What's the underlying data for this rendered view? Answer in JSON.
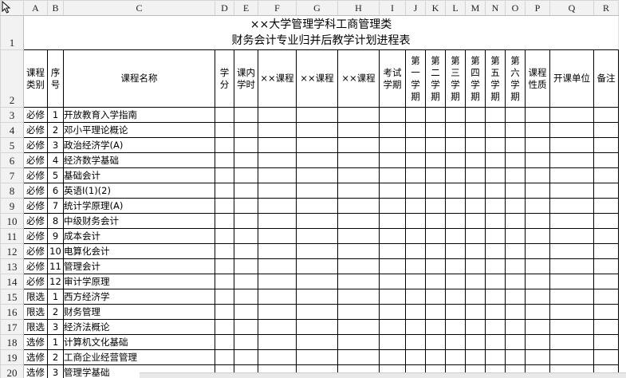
{
  "columns": [
    "A",
    "B",
    "C",
    "D",
    "E",
    "F",
    "G",
    "H",
    "I",
    "J",
    "K",
    "L",
    "M",
    "N",
    "O",
    "P",
    "Q",
    "R"
  ],
  "rows": [
    "1",
    "2",
    "3",
    "4",
    "5",
    "6",
    "7",
    "8",
    "9",
    "10",
    "11",
    "12",
    "13",
    "14",
    "15",
    "16",
    "17",
    "18",
    "19",
    "20"
  ],
  "title": {
    "line1": "××大学管理学科工商管理类",
    "line2": "财务会计专业归并后教学计划进程表"
  },
  "headers": {
    "category": "课程类别",
    "seq": "序号",
    "name": "课程名称",
    "credit": "学分",
    "hours": "课内学时",
    "course1": "××课程",
    "course2": "××课程",
    "course3": "××课程",
    "exam": "考试学期",
    "term1": "第一学期",
    "term2": "第二学期",
    "term3": "第三学期",
    "term4": "第四学期",
    "term5": "第五学期",
    "term6": "第六学期",
    "nature": "课程性质",
    "unit": "开课单位",
    "remark": "备注"
  },
  "courses": [
    {
      "category": "必修",
      "seq": "1",
      "name": "开放教育入学指南"
    },
    {
      "category": "必修",
      "seq": "2",
      "name": "邓小平理论概论"
    },
    {
      "category": "必修",
      "seq": "3",
      "name": "政治经济学(A)"
    },
    {
      "category": "必修",
      "seq": "4",
      "name": "经济数学基础"
    },
    {
      "category": "必修",
      "seq": "5",
      "name": "基础会计"
    },
    {
      "category": "必修",
      "seq": "6",
      "name": "英语Ⅰ(1)(2)"
    },
    {
      "category": "必修",
      "seq": "7",
      "name": "统计学原理(A)"
    },
    {
      "category": "必修",
      "seq": "8",
      "name": "中级财务会计"
    },
    {
      "category": "必修",
      "seq": "9",
      "name": "成本会计"
    },
    {
      "category": "必修",
      "seq": "10",
      "name": "电算化会计"
    },
    {
      "category": "必修",
      "seq": "11",
      "name": "管理会计"
    },
    {
      "category": "必修",
      "seq": "12",
      "name": "审计学原理"
    },
    {
      "category": "限选",
      "seq": "1",
      "name": "西方经济学"
    },
    {
      "category": "限选",
      "seq": "2",
      "name": "财务管理"
    },
    {
      "category": "限选",
      "seq": "3",
      "name": "经济法概论"
    },
    {
      "category": "选修",
      "seq": "1",
      "name": "计算机文化基础"
    },
    {
      "category": "选修",
      "seq": "2",
      "name": "工商企业经营管理"
    },
    {
      "category": "选修",
      "seq": "3",
      "name": "管理学基础"
    }
  ]
}
